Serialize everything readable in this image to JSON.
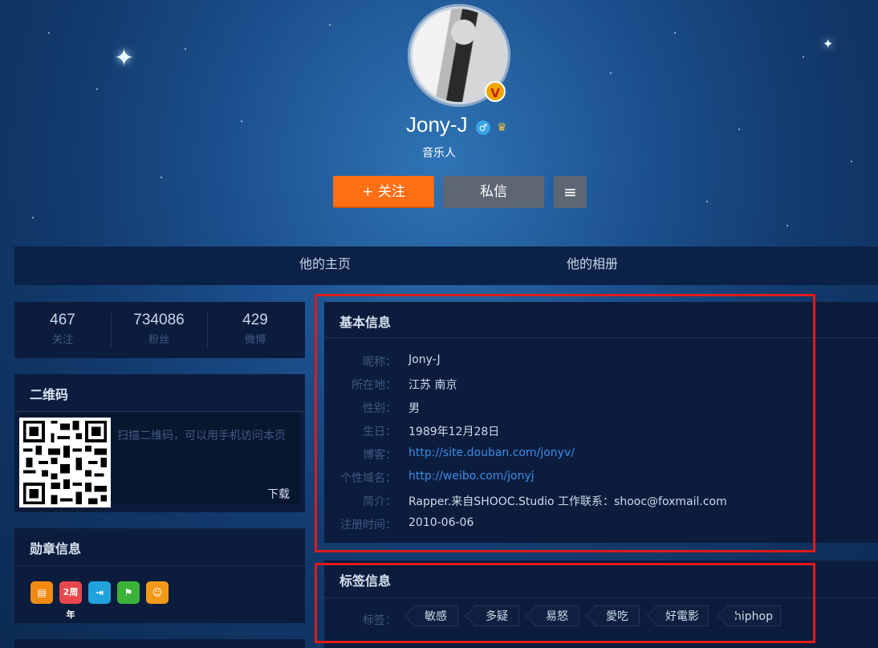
{
  "profile": {
    "name": "Jony-J",
    "subtitle": "音乐人",
    "verified_badge": "V",
    "gender_icon": "male-icon",
    "vip_icon": "vip-crown-icon"
  },
  "actions": {
    "follow": "+ 关注",
    "message": "私信",
    "more": "≡"
  },
  "nav": {
    "home": "他的主页",
    "album": "他的相册"
  },
  "stats": [
    {
      "value": "467",
      "label": "关注"
    },
    {
      "value": "734086",
      "label": "粉丝"
    },
    {
      "value": "429",
      "label": "微博"
    }
  ],
  "qrcode": {
    "title": "二维码",
    "desc": "扫描二维码，可以用手机访问本页",
    "download": "下载"
  },
  "medals": {
    "title": "勋章信息",
    "items": [
      "card-medal-icon",
      "2周年",
      "door-medal-icon",
      "run-medal-icon",
      "mask-medal-icon"
    ]
  },
  "basic_info": {
    "title": "基本信息",
    "rows": [
      {
        "label": "昵称：",
        "value": "Jony-J"
      },
      {
        "label": "所在地：",
        "value": "江苏 南京"
      },
      {
        "label": "性别：",
        "value": "男"
      },
      {
        "label": "生日：",
        "value": "1989年12月28日"
      },
      {
        "label": "博客：",
        "value": "http://site.douban.com/jonyv/"
      },
      {
        "label": "个性域名：",
        "value": "http://weibo.com/jonyj"
      },
      {
        "label": "简介：",
        "value": "Rapper.来自SHOOC.Studio 工作联系：shooc@foxmail.com"
      },
      {
        "label": "注册时间：",
        "value": "2010-06-06"
      }
    ]
  },
  "tags_info": {
    "title": "标签信息",
    "label": "标签：",
    "tags": [
      "敏感",
      "多疑",
      "易怒",
      "愛吃",
      "好電影",
      "hiphop"
    ]
  },
  "colors": {
    "follow_button": "#ff6f16",
    "link": "#3a8ee6",
    "highlight": "#e01b1b"
  }
}
